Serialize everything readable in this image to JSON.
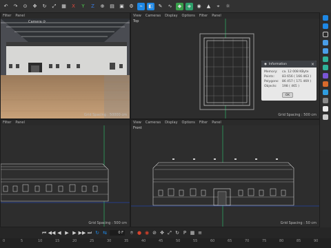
{
  "top_left_menu": [
    "Filter",
    "Panel"
  ],
  "viewport_menu": [
    "View",
    "Cameras",
    "Display",
    "Options",
    "Filter",
    "Panel"
  ],
  "viewports": {
    "perspective": {
      "label": "Camera ⟳",
      "grid": "Grid Spacing : 50000 cm"
    },
    "top": {
      "label": "Top",
      "grid": "Grid Spacing : 500 cm"
    },
    "right": {
      "label": "",
      "grid": "Grid Spacing : 500 cm"
    },
    "front": {
      "label": "Front",
      "grid": "Grid Spacing : 50 cm"
    }
  },
  "info_dialog": {
    "title": "Information",
    "rows": [
      {
        "k": "Memory:",
        "v": "ca. 12 008 KByte"
      },
      {
        "k": "Points:",
        "v": "83 656 ( 166 463 )"
      },
      {
        "k": "Polygons:",
        "v": "86 457 ( 171 469 )"
      },
      {
        "k": "Objects:",
        "v": "198 ( 465 )"
      }
    ],
    "ok": "OK"
  },
  "timeline": {
    "frame_field": "0 F",
    "ruler_ticks": [
      "0",
      "5",
      "10",
      "15",
      "20",
      "25",
      "30",
      "35",
      "40",
      "45",
      "50",
      "55",
      "60",
      "65",
      "70",
      "75",
      "80",
      "85",
      "90"
    ]
  },
  "colors": {
    "accent": "#1e88e5",
    "record": "#d8422c",
    "axis_green": "#2ecc71",
    "axis_blue": "#1f4fe0"
  }
}
